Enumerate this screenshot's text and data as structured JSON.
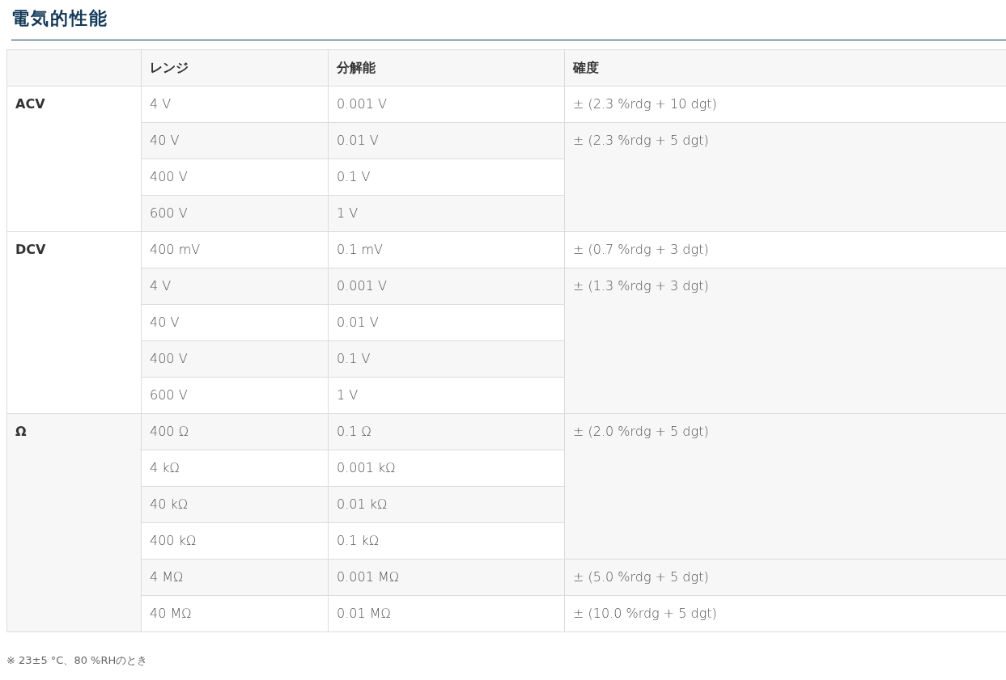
{
  "title": "電気的性能",
  "table": {
    "columns": [
      "",
      "レンジ",
      "分解能",
      "確度"
    ],
    "groups": [
      {
        "function": "ACV",
        "accuracy_groups": [
          {
            "accuracy": "± (2.3 %rdg + 10 dgt)",
            "rows": [
              {
                "range": "4 V",
                "resolution": "0.001 V"
              }
            ]
          },
          {
            "accuracy": "± (2.3 %rdg + 5 dgt)",
            "rows": [
              {
                "range": "40 V",
                "resolution": "0.01 V"
              },
              {
                "range": "400 V",
                "resolution": "0.1 V"
              },
              {
                "range": "600 V",
                "resolution": "1 V"
              }
            ]
          }
        ]
      },
      {
        "function": "DCV",
        "accuracy_groups": [
          {
            "accuracy": "± (0.7 %rdg + 3 dgt)",
            "rows": [
              {
                "range": "400 mV",
                "resolution": "0.1 mV"
              }
            ]
          },
          {
            "accuracy": "± (1.3 %rdg + 3 dgt)",
            "rows": [
              {
                "range": "4 V",
                "resolution": "0.001 V"
              },
              {
                "range": "40 V",
                "resolution": "0.01 V"
              },
              {
                "range": "400 V",
                "resolution": "0.1 V"
              },
              {
                "range": "600 V",
                "resolution": "1 V"
              }
            ]
          }
        ]
      },
      {
        "function": "Ω",
        "accuracy_groups": [
          {
            "accuracy": "± (2.0 %rdg + 5 dgt)",
            "rows": [
              {
                "range": "400 Ω",
                "resolution": "0.1 Ω"
              },
              {
                "range": "4 kΩ",
                "resolution": "0.001 kΩ"
              },
              {
                "range": "40 kΩ",
                "resolution": "0.01 kΩ"
              },
              {
                "range": "400 kΩ",
                "resolution": "0.1 kΩ"
              }
            ]
          },
          {
            "accuracy": "± (5.0 %rdg + 5 dgt)",
            "rows": [
              {
                "range": "4 MΩ",
                "resolution": "0.001 MΩ"
              }
            ]
          },
          {
            "accuracy": "± (10.0 %rdg + 5 dgt)",
            "rows": [
              {
                "range": "40 MΩ",
                "resolution": "0.01 MΩ"
              }
            ]
          }
        ]
      }
    ]
  },
  "note": "※ 23±5 °C、80 %RHのとき"
}
